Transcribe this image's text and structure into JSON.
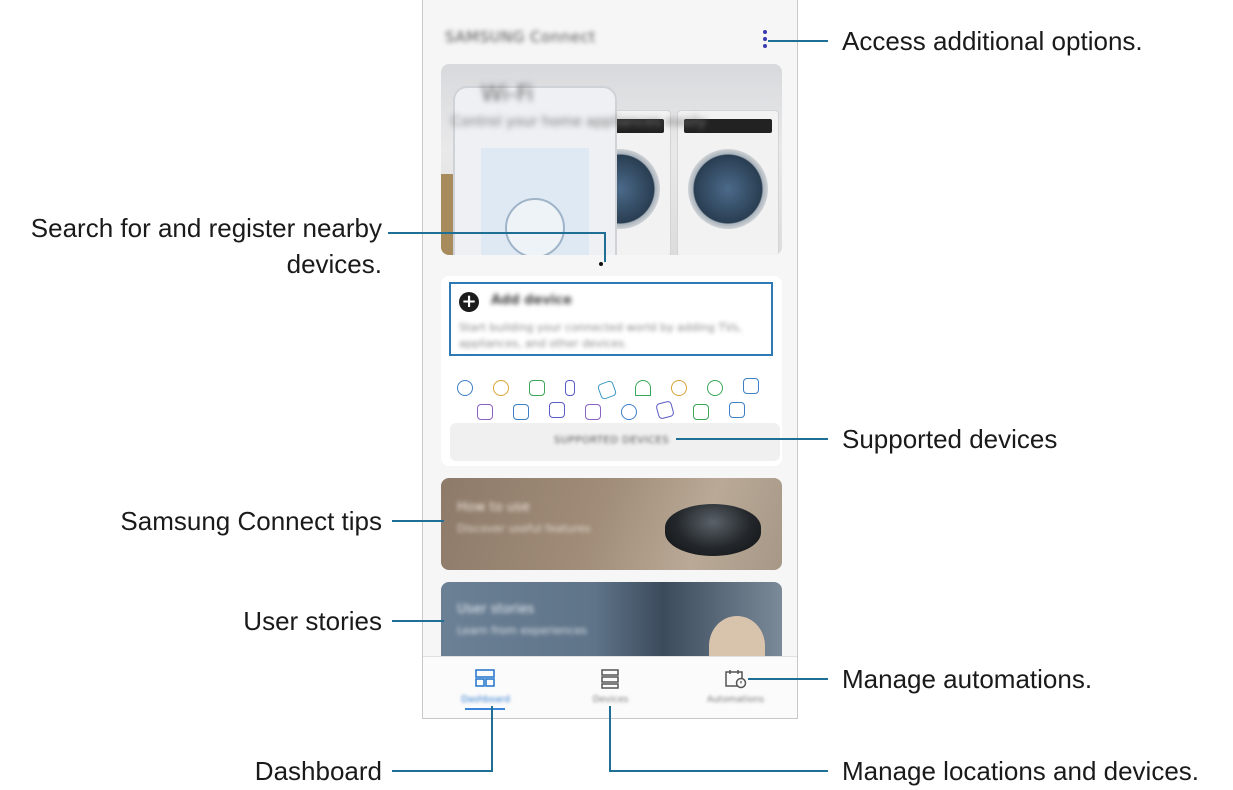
{
  "app": {
    "title": "SAMSUNG Connect"
  },
  "hero": {
    "blur_text": "Wi-Fi",
    "blur_sub": "Control your home appliances easily"
  },
  "add_device": {
    "title": "Add device",
    "description": "Start building your connected world by adding TVs, appliances, and other devices."
  },
  "supported_devices_button": "SUPPORTED DEVICES",
  "tips_card": {
    "title": "How to use",
    "subtitle": "Discover useful features"
  },
  "stories_card": {
    "title": "User stories",
    "subtitle": "Learn from experiences"
  },
  "bottom_nav": [
    {
      "label": "Dashboard",
      "icon": "dashboard-icon",
      "active": true
    },
    {
      "label": "Devices",
      "icon": "devices-icon",
      "active": false
    },
    {
      "label": "Automations",
      "icon": "automations-icon",
      "active": false
    }
  ],
  "callouts": {
    "options": "Access additional options.",
    "search_line1": "Search for and register nearby",
    "search_line2": "devices.",
    "supported": "Supported devices",
    "tips": "Samsung Connect tips",
    "stories": "User stories",
    "automations": "Manage automations.",
    "dashboard": "Dashboard",
    "locations": "Manage locations and devices."
  },
  "colors": {
    "callout_line": "#1f6f94",
    "highlight_border": "#2f79b5",
    "active_tab": "#3a84da"
  }
}
